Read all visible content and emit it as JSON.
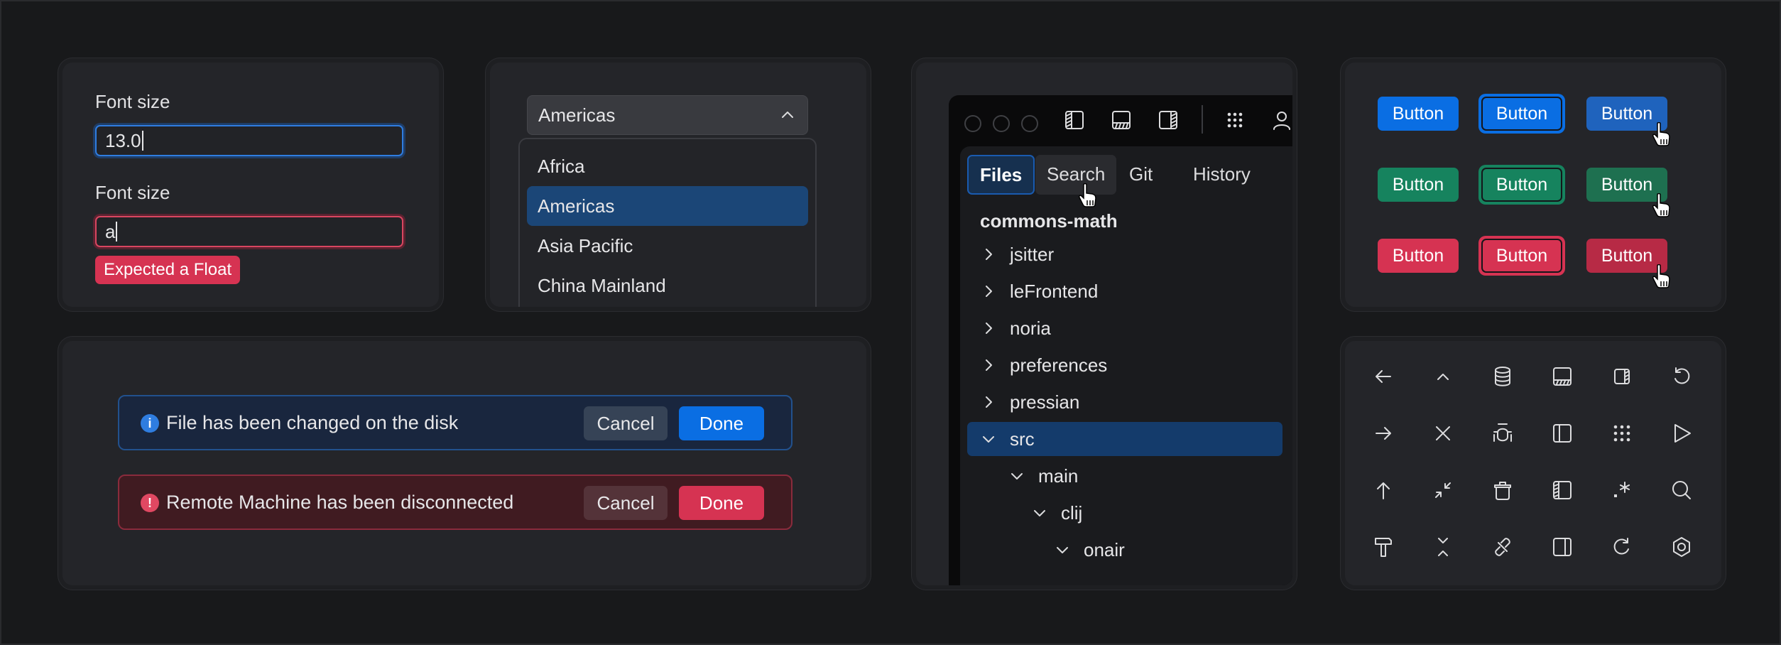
{
  "font_size_form": {
    "field1": {
      "label": "Font size",
      "value": "13.0",
      "state": "focused"
    },
    "field2": {
      "label": "Font size",
      "value": "a",
      "state": "error",
      "error": "Expected a Float"
    }
  },
  "region_dropdown": {
    "selected": "Americas",
    "options": [
      "Africa",
      "Americas",
      "Asia Pacific",
      "China Mainland"
    ],
    "highlighted_index": 1
  },
  "ide": {
    "tabs": [
      {
        "label": "Files",
        "state": "active"
      },
      {
        "label": "Search",
        "state": "hover"
      },
      {
        "label": "Git",
        "state": "normal"
      },
      {
        "label": "History",
        "state": "normal"
      }
    ],
    "tree": {
      "root": "commons-math",
      "items": [
        {
          "label": "jsitter",
          "depth": 0,
          "expanded": false
        },
        {
          "label": "leFrontend",
          "depth": 0,
          "expanded": false
        },
        {
          "label": "noria",
          "depth": 0,
          "expanded": false
        },
        {
          "label": "preferences",
          "depth": 0,
          "expanded": false
        },
        {
          "label": "pressian",
          "depth": 0,
          "expanded": false
        },
        {
          "label": "src",
          "depth": 0,
          "expanded": true,
          "selected": true
        },
        {
          "label": "main",
          "depth": 1,
          "expanded": true
        },
        {
          "label": "clij",
          "depth": 2,
          "expanded": true
        },
        {
          "label": "onair",
          "depth": 3,
          "expanded": true
        }
      ]
    },
    "toolbar_icons": [
      "traffic-light-close",
      "traffic-light-minimize",
      "traffic-light-zoom",
      "left-panel-icon",
      "bottom-panel-icon",
      "right-panel-icon",
      "apps-grid-icon",
      "user-icon"
    ]
  },
  "buttons": {
    "label": "Button",
    "rows": [
      {
        "variant": "primary",
        "states": [
          "default",
          "focused",
          "hover"
        ]
      },
      {
        "variant": "success",
        "states": [
          "default",
          "focused",
          "hover"
        ]
      },
      {
        "variant": "danger",
        "states": [
          "default",
          "focused",
          "hover"
        ]
      }
    ],
    "colors": {
      "primary": "#0a6ee3",
      "success": "#16835e",
      "danger": "#d63352"
    }
  },
  "banners": [
    {
      "type": "info",
      "icon": "info-icon",
      "message": "File has been changed on the disk",
      "cancel": "Cancel",
      "done": "Done"
    },
    {
      "type": "error",
      "icon": "error-icon",
      "message": "Remote Machine has been disconnected",
      "cancel": "Cancel",
      "done": "Done"
    }
  ],
  "icon_grid": [
    [
      "arrow-left-icon",
      "chevron-up-icon",
      "database-icon",
      "bottom-panel-icon",
      "right-panel-icon",
      "undo-icon"
    ],
    [
      "arrow-right-icon",
      "close-icon",
      "bug-icon",
      "left-sidebar-icon",
      "apps-grid-icon",
      "play-icon"
    ],
    [
      "arrow-up-icon",
      "collapse-icon",
      "trash-icon",
      "left-panel-icon",
      "regex-icon",
      "search-icon"
    ],
    [
      "hammer-icon",
      "collapse-vertical-icon",
      "unlink-icon",
      "right-sidebar-icon",
      "redo-icon",
      "settings-hexagon-icon"
    ]
  ]
}
